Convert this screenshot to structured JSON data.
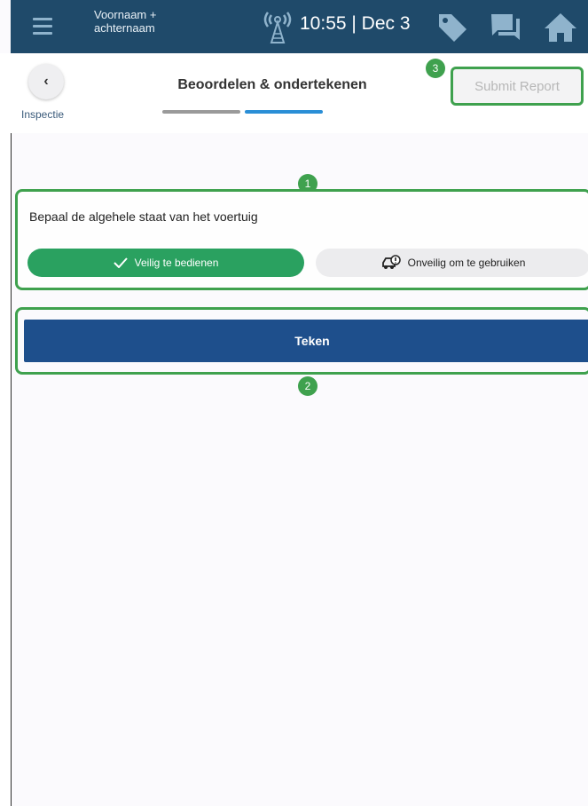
{
  "statusbar": {
    "user_name": "Voornaam + achternaam",
    "time_date": "10:55 | Dec 3"
  },
  "header": {
    "back_label": "Inspectie",
    "title": "Beoordelen & ondertekenen",
    "submit_label": "Submit Report",
    "progress_steps": 2,
    "current_step": 2
  },
  "condition": {
    "prompt": "Bepaal de algehele staat van het voertuig",
    "safe_label": "Veilig te bedienen",
    "unsafe_label": "Onveilig om te gebruiken",
    "selected": "safe"
  },
  "sign": {
    "label": "Teken"
  },
  "badges": {
    "one": "1",
    "two": "2",
    "three": "3"
  },
  "colors": {
    "topbar": "#1f4a6a",
    "accent_green": "#2aa160",
    "highlight": "#3fa14e",
    "sign_blue": "#1e4f8c",
    "progress_active": "#2a8ed6"
  }
}
